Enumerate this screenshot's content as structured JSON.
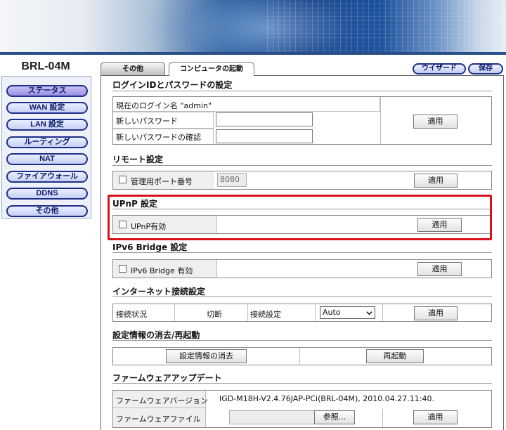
{
  "brand": "BRL-04M",
  "nav": {
    "items": [
      {
        "label": "ステータス",
        "active": true
      },
      {
        "label": "WAN 設定"
      },
      {
        "label": "LAN 設定"
      },
      {
        "label": "ルーティング"
      },
      {
        "label": "NAT"
      },
      {
        "label": "ファイアウォール"
      },
      {
        "label": "DDNS"
      },
      {
        "label": "その他"
      }
    ]
  },
  "tabs": [
    {
      "label": "その他"
    },
    {
      "label": "コンピュータの起動"
    }
  ],
  "header_buttons": {
    "wizard": "ウイザード",
    "save": "保存"
  },
  "apply_label": "適用",
  "login": {
    "title": "ログインIDとパスワードの設定",
    "current_login": "現在のログイン名 \"admin\"",
    "new_password_label": "新しいパスワード",
    "confirm_password_label": "新しいパスワードの確認",
    "new_password_value": "",
    "confirm_password_value": ""
  },
  "remote": {
    "title": "リモート設定",
    "port_label": "管理用ポート番号",
    "port_value": "8080",
    "checked": false
  },
  "upnp": {
    "title": "UPnP 設定",
    "label": "UPnP有効",
    "checked": false
  },
  "ipv6": {
    "title": "IPv6 Bridge 設定",
    "label": "IPv6 Bridge 有効",
    "checked": false
  },
  "internet": {
    "title": "インターネット接続設定",
    "status_label": "接続状況",
    "status_value": "切断",
    "setting_label": "接続設定",
    "setting_value": "Auto"
  },
  "reset": {
    "title": "設定情報の消去/再起動",
    "clear_label": "設定情報の消去",
    "reboot_label": "再起動"
  },
  "firmware": {
    "title": "ファームウェアアップデート",
    "version_label": "ファームウェアバージョン",
    "version_value": "IGD-M18H-V2.4.76JAP-PCi(BRL-04M), 2010.04.27.11:40.",
    "file_label": "ファームウェアファイル",
    "browse_label": "参照..."
  },
  "colors": {
    "highlight": "#d8121a",
    "nav_border": "#1d2f8a"
  }
}
